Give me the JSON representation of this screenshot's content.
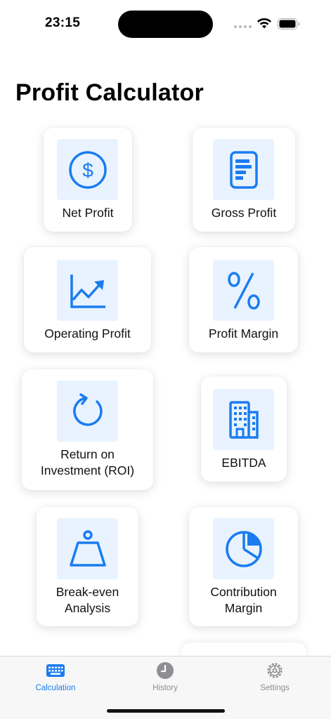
{
  "status_bar": {
    "time": "23:15"
  },
  "page_title": "Profit Calculator",
  "colors": {
    "accent": "#1a7cf0",
    "tile_bg": "#e8f3ff",
    "tab_inactive": "#8e8e93"
  },
  "cards": [
    {
      "label": "Net Profit",
      "icon": "dollar-circle-icon"
    },
    {
      "label": "Gross Profit",
      "icon": "document-bars-icon"
    },
    {
      "label": "Operating Profit",
      "icon": "trending-chart-icon"
    },
    {
      "label": "Profit Margin",
      "icon": "percent-icon"
    },
    {
      "label": "Return on\nInvestment (ROI)",
      "icon": "rotate-arrow-icon"
    },
    {
      "label": "EBITDA",
      "icon": "building-icon"
    },
    {
      "label": "Break-even\nAnalysis",
      "icon": "weight-icon"
    },
    {
      "label": "Contribution\nMargin",
      "icon": "pie-chart-icon"
    }
  ],
  "tabs": [
    {
      "label": "Calculation",
      "icon": "keyboard-icon",
      "selected": true
    },
    {
      "label": "History",
      "icon": "clock-icon",
      "selected": false
    },
    {
      "label": "Settings",
      "icon": "gear-icon",
      "selected": false
    }
  ]
}
